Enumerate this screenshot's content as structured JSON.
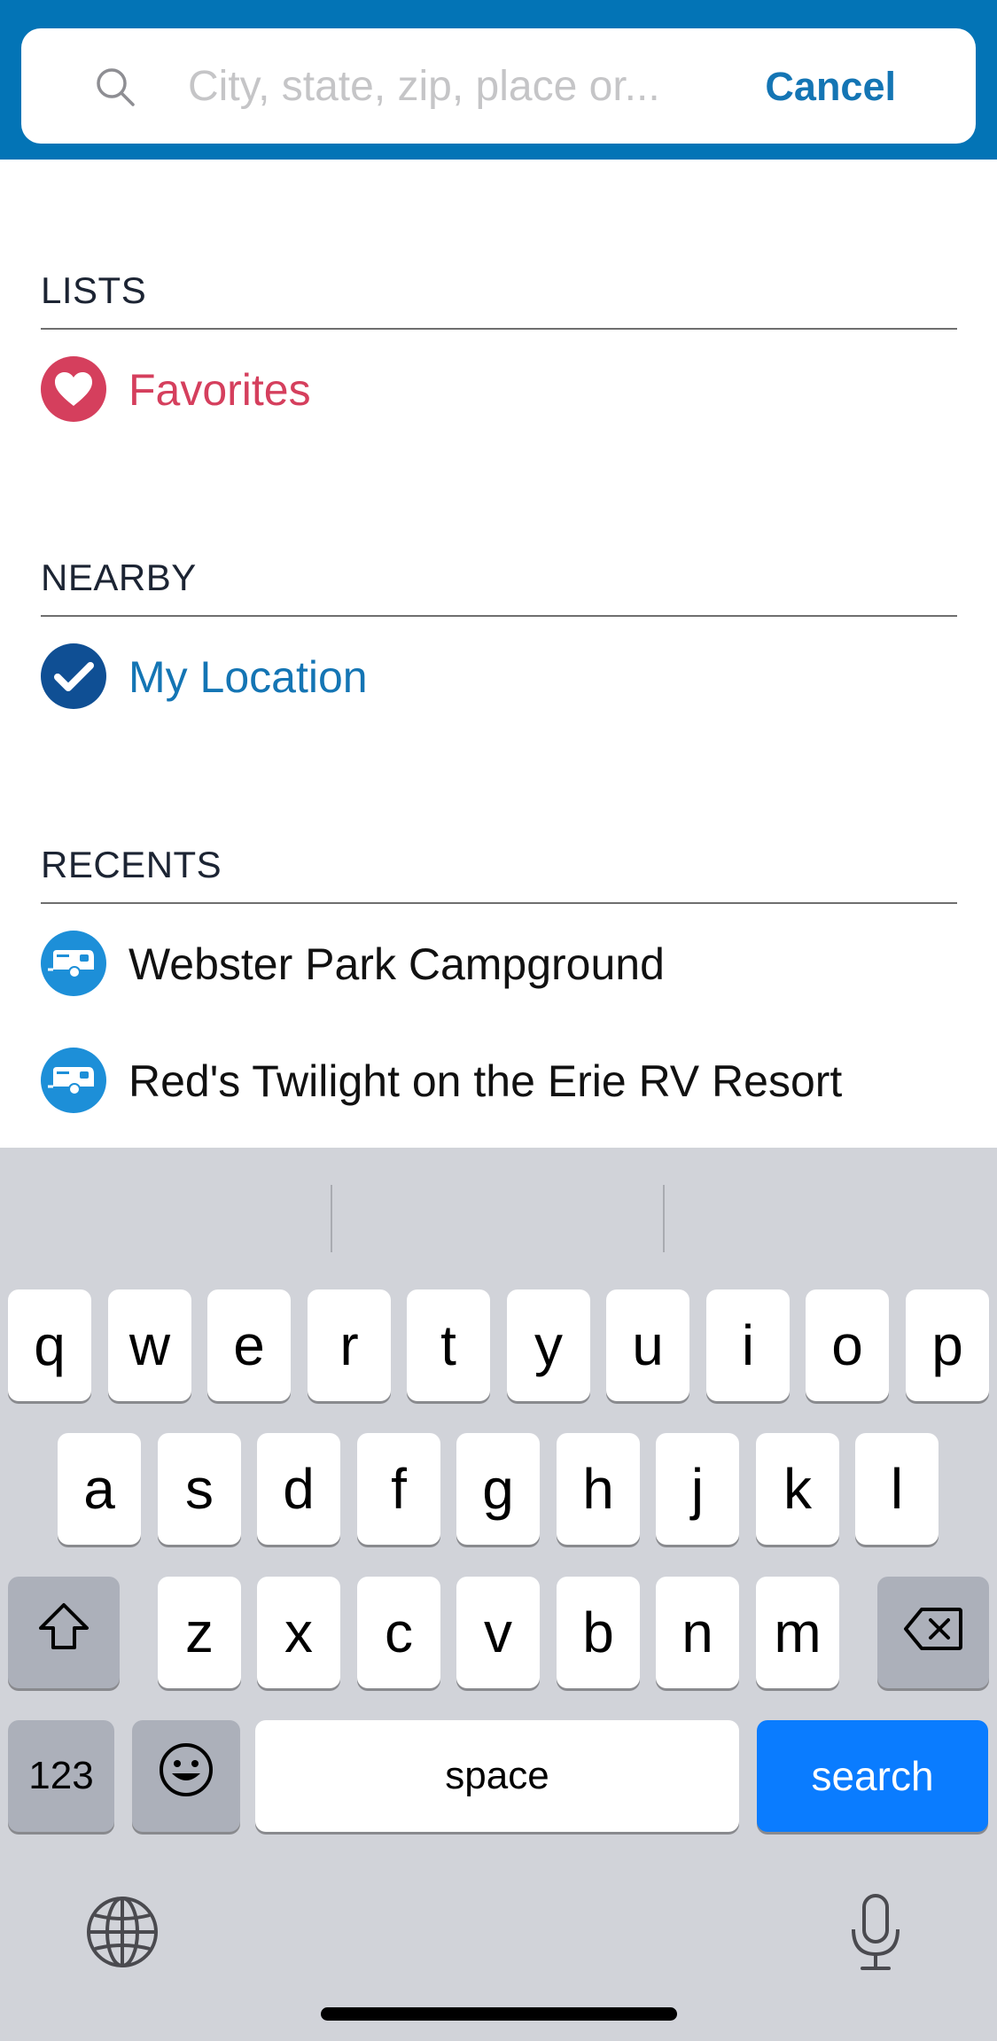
{
  "search": {
    "placeholder": "City, state, zip, place or...",
    "value": "",
    "cancel_label": "Cancel"
  },
  "colors": {
    "header_blue": "#0374b6",
    "accent_blue": "#1475b4",
    "favorites_red": "#d53f5d",
    "keyboard_bg": "#d1d3d9",
    "search_key": "#0a7cff"
  },
  "sections": {
    "lists": {
      "title": "LISTS",
      "items": [
        {
          "label": "Favorites",
          "icon": "heart-icon"
        }
      ]
    },
    "nearby": {
      "title": "NEARBY",
      "items": [
        {
          "label": "My Location",
          "icon": "checkmark-icon"
        }
      ]
    },
    "recents": {
      "title": "RECENTS",
      "items": [
        {
          "label": "Webster Park Campground",
          "icon": "rv-trailer-icon"
        },
        {
          "label": "Red's Twilight on the Erie RV Resort",
          "icon": "rv-trailer-icon"
        }
      ]
    }
  },
  "keyboard": {
    "row1": [
      "q",
      "w",
      "e",
      "r",
      "t",
      "y",
      "u",
      "i",
      "o",
      "p"
    ],
    "row2": [
      "a",
      "s",
      "d",
      "f",
      "g",
      "h",
      "j",
      "k",
      "l"
    ],
    "row3": [
      "z",
      "x",
      "c",
      "v",
      "b",
      "n",
      "m"
    ],
    "numbers_label": "123",
    "space_label": "space",
    "search_label": "search",
    "icons": [
      "shift-icon",
      "delete-icon",
      "emoji-icon",
      "globe-icon",
      "microphone-icon"
    ]
  }
}
